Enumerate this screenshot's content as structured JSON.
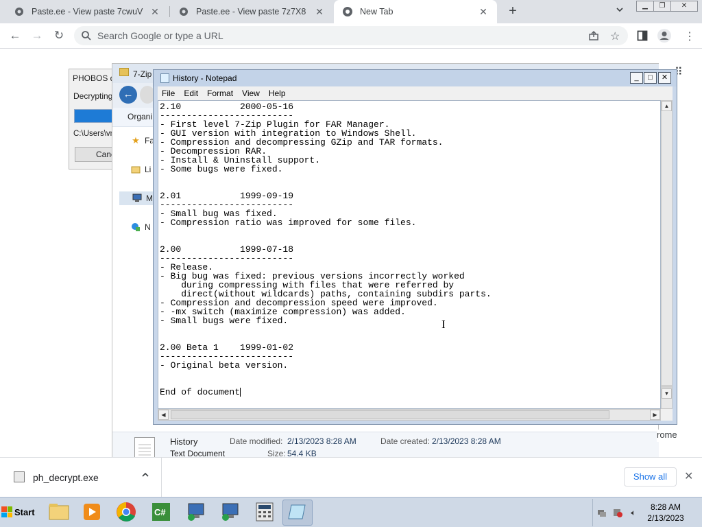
{
  "browser": {
    "tabs": [
      {
        "title": "Paste.ee - View paste 7cwuV",
        "icon": "pastee-icon",
        "active": false
      },
      {
        "title": "Paste.ee - View paste 7z7X8",
        "icon": "pastee-icon",
        "active": false
      },
      {
        "title": "New Tab",
        "icon": "chrome-icon",
        "active": true
      }
    ],
    "new_tab_label": "+",
    "tab_search_label": "⌄",
    "omnibox_placeholder": "Search Google or type a URL"
  },
  "phobos_dialog": {
    "title": "PHOBOS d",
    "message": "Decrypting .",
    "path": "C:\\Users\\vn",
    "cancel_label": "Cancel"
  },
  "explorer": {
    "title": "7-Zip",
    "organize_label": "Organi",
    "nav_items": [
      {
        "label": "Fa",
        "icon": "star-icon"
      },
      {
        "label": "Li",
        "icon": "library-icon"
      },
      {
        "label": "M",
        "icon": "computer-icon"
      },
      {
        "label": "N",
        "icon": "network-icon"
      }
    ],
    "details": {
      "name": "History",
      "type": "Text Document",
      "modified_label": "Date modified:",
      "modified": "2/13/2023 8:28 AM",
      "created_label": "Date created:",
      "created": "2/13/2023 8:28 AM",
      "size_label": "Size:",
      "size": "54.4 KB"
    }
  },
  "notepad": {
    "title": "History - Notepad",
    "controls": {
      "minimize": "_",
      "maximize": "□",
      "close": "✕"
    },
    "menu": [
      "File",
      "Edit",
      "Format",
      "View",
      "Help"
    ],
    "lines": [
      "2.10           2000-05-16",
      "-------------------------",
      "- First level 7-Zip Plugin for FAR Manager.",
      "- GUI version with integration to Windows Shell.",
      "- Compression and decompressing GZip and TAR formats.",
      "- Decompression RAR.",
      "- Install & Uninstall support.",
      "- Some bugs were fixed.",
      "",
      "",
      "2.01           1999-09-19",
      "-------------------------",
      "- Small bug was fixed.",
      "- Compression ratio was improved for some files.",
      "",
      "",
      "2.00           1999-07-18",
      "-------------------------",
      "- Release.",
      "- Big bug was fixed: previous versions incorrectly worked",
      "    during compressing with files that were referred by",
      "    direct(without wildcards) paths, containing subdirs parts.",
      "- Compression and decompression speed were improved.",
      "- -mx switch (maximize compression) was added.",
      "- Small bugs were fixed.",
      "",
      "",
      "2.00 Beta 1    1999-01-02",
      "-------------------------",
      "- Original beta version.",
      "",
      "",
      "End of document"
    ]
  },
  "downloads": {
    "file_name": "ph_decrypt.exe",
    "show_all_label": "Show all",
    "close_label": "✕",
    "caret": "^"
  },
  "chrome_tooltip": "rome",
  "taskbar": {
    "start_label": "Start",
    "apps": [
      "explorer",
      "media-player",
      "chrome",
      "csharp-editor",
      "network-tool",
      "network-tool-2",
      "calculator",
      "notepad"
    ],
    "time": "8:28 AM",
    "date": "2/13/2023"
  }
}
